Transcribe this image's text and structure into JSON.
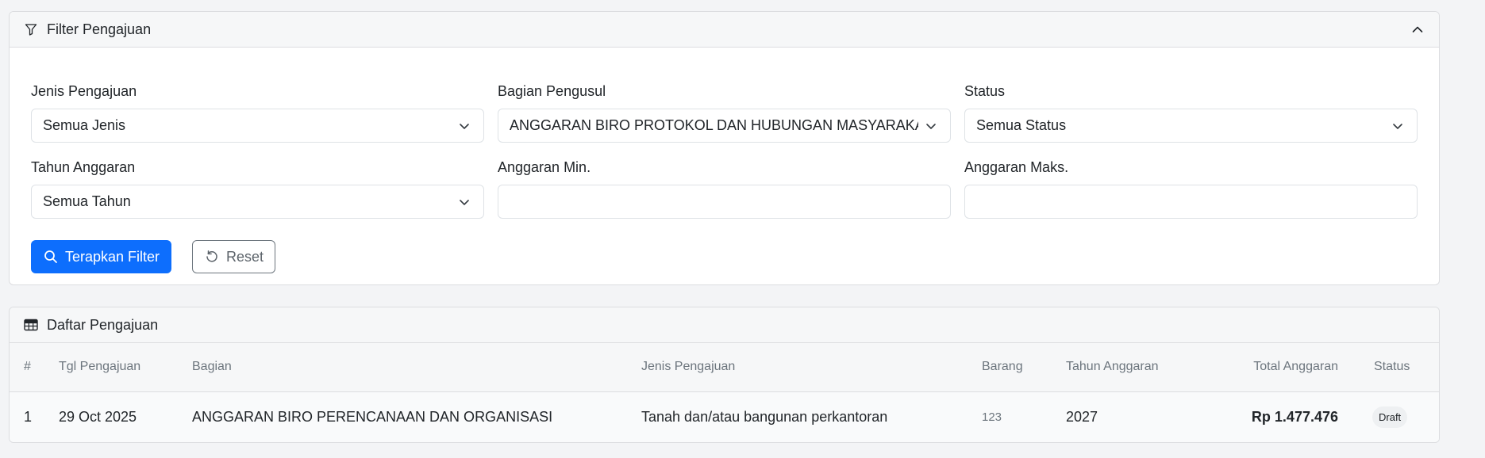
{
  "filter": {
    "title": "Filter Pengajuan",
    "icons": {
      "header": "filter-icon",
      "collapse": "chevron-up-icon"
    },
    "fields": {
      "jenis": {
        "label": "Jenis Pengajuan",
        "value": "Semua Jenis"
      },
      "bagian": {
        "label": "Bagian Pengusul",
        "value": "ANGGARAN BIRO PROTOKOL DAN HUBUNGAN MASYARAKAT"
      },
      "status": {
        "label": "Status",
        "value": "Semua Status"
      },
      "tahun": {
        "label": "Tahun Anggaran",
        "value": "Semua Tahun"
      },
      "min": {
        "label": "Anggaran Min.",
        "value": ""
      },
      "maks": {
        "label": "Anggaran Maks.",
        "value": ""
      }
    },
    "apply_label": "Terapkan Filter",
    "reset_label": "Reset"
  },
  "table": {
    "title": "Daftar Pengajuan",
    "columns": {
      "num": "#",
      "date": "Tgl Pengajuan",
      "bagian": "Bagian",
      "jenis": "Jenis Pengajuan",
      "barang": "Barang",
      "tahun": "Tahun Anggaran",
      "total": "Total Anggaran",
      "status": "Status"
    },
    "rows": [
      {
        "num": "1",
        "date": "29 Oct 2025",
        "bagian": "ANGGARAN BIRO PERENCANAAN DAN ORGANISASI",
        "jenis": "Tanah dan/atau bangunan perkantoran",
        "barang": "123",
        "tahun": "2027",
        "total": "Rp 1.477.476",
        "status": "Draft"
      }
    ]
  },
  "colors": {
    "primary": "#0d6efd",
    "header_bg": "#f6f7f8",
    "border": "#dcdde0"
  }
}
